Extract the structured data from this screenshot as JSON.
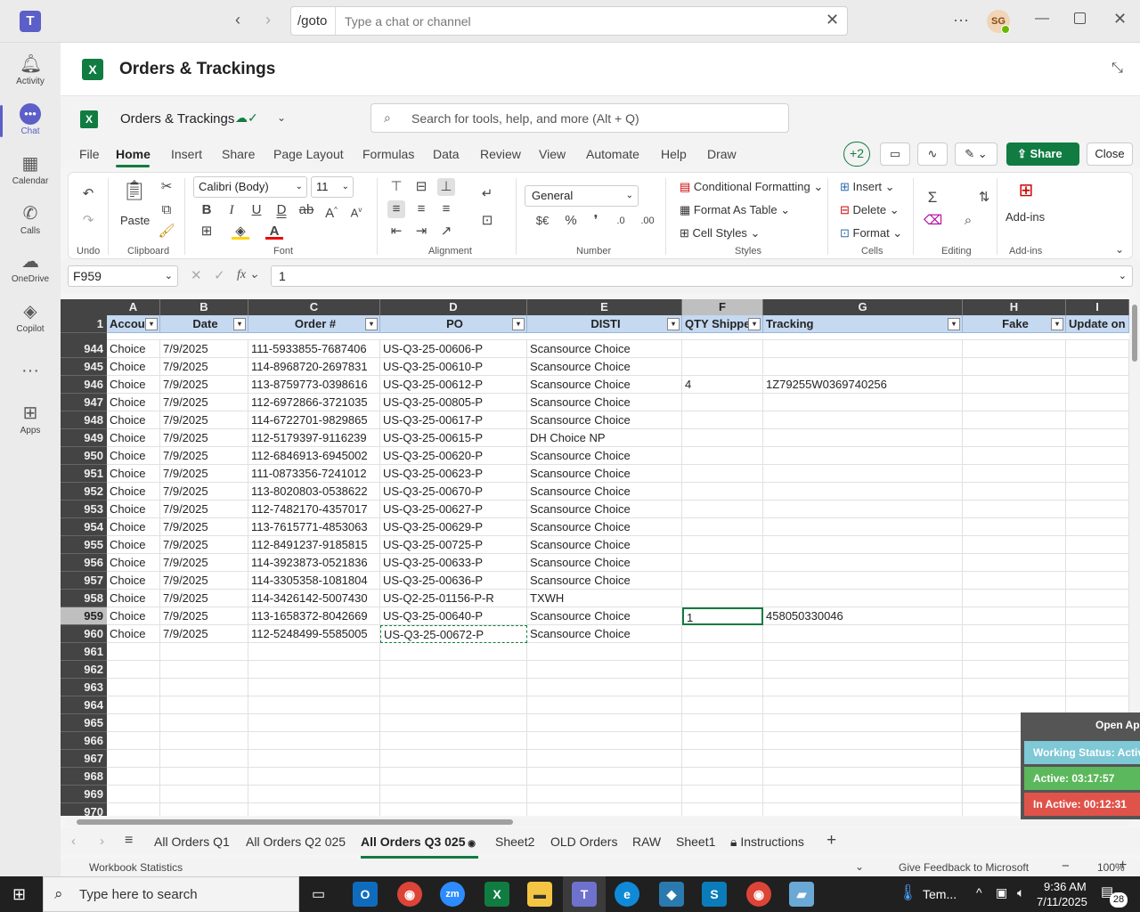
{
  "teams": {
    "goto_label": "/goto",
    "search_placeholder": "Type a chat or channel",
    "avatar_initials": "SG",
    "rail": [
      {
        "label": "Activity",
        "icon": "bell-icon"
      },
      {
        "label": "Chat",
        "icon": "chat-icon"
      },
      {
        "label": "Calendar",
        "icon": "calendar-icon"
      },
      {
        "label": "Calls",
        "icon": "phone-icon"
      },
      {
        "label": "OneDrive",
        "icon": "cloud-icon"
      },
      {
        "label": "Copilot",
        "icon": "copilot-icon"
      },
      {
        "label": "Apps",
        "icon": "apps-icon"
      }
    ]
  },
  "app": {
    "title": "Orders & Trackings"
  },
  "excel": {
    "file_name": "Orders & Trackings",
    "search_placeholder": "Search for tools, help, and more (Alt + Q)",
    "menu_tabs": [
      "File",
      "Home",
      "Insert",
      "Share",
      "Page Layout",
      "Formulas",
      "Data",
      "Review",
      "View",
      "Automate",
      "Help",
      "Draw"
    ],
    "selected_tab": "Home",
    "presence_count": "+2",
    "share_label": "Share",
    "close_label": "Close",
    "ribbon": {
      "undo_label": "Undo",
      "paste_label": "Paste",
      "clipboard_label": "Clipboard",
      "font_name": "Calibri (Body)",
      "font_size": "11",
      "font_label": "Font",
      "alignment_label": "Alignment",
      "number_format": "General",
      "number_label": "Number",
      "conditional_formatting": "Conditional Formatting",
      "format_as_table": "Format As Table",
      "cell_styles": "Cell Styles",
      "styles_label": "Styles",
      "insert": "Insert",
      "delete": "Delete",
      "format": "Format",
      "cells_label": "Cells",
      "editing_label": "Editing",
      "addins_btn": "Add-ins",
      "addins_label": "Add-ins"
    },
    "name_box": "F959",
    "formula_value": "1",
    "columns": [
      {
        "letter": "A",
        "header": "Accou"
      },
      {
        "letter": "B",
        "header": "Date"
      },
      {
        "letter": "C",
        "header": "Order #"
      },
      {
        "letter": "D",
        "header": "PO"
      },
      {
        "letter": "E",
        "header": "DISTI"
      },
      {
        "letter": "F",
        "header": "QTY Shipped"
      },
      {
        "letter": "G",
        "header": "Tracking"
      },
      {
        "letter": "H",
        "header": "Fake"
      },
      {
        "letter": "I",
        "header": "Update on A"
      }
    ],
    "header_row_number": "1",
    "rows": [
      {
        "n": "944",
        "a": "Choice",
        "b": "7/9/2025",
        "c": "111-5933855-7687406",
        "d": "US-Q3-25-00606-P",
        "e": "Scansource Choice",
        "f": "",
        "g": ""
      },
      {
        "n": "945",
        "a": "Choice",
        "b": "7/9/2025",
        "c": "114-8968720-2697831",
        "d": "US-Q3-25-00610-P",
        "e": "Scansource Choice",
        "f": "",
        "g": ""
      },
      {
        "n": "946",
        "a": "Choice",
        "b": "7/9/2025",
        "c": "113-8759773-0398616",
        "d": "US-Q3-25-00612-P",
        "e": "Scansource Choice",
        "f": "4",
        "g": "1Z79255W0369740256"
      },
      {
        "n": "947",
        "a": "Choice",
        "b": "7/9/2025",
        "c": "112-6972866-3721035",
        "d": "US-Q3-25-00805-P",
        "e": "Scansource Choice",
        "f": "",
        "g": ""
      },
      {
        "n": "948",
        "a": "Choice",
        "b": "7/9/2025",
        "c": "114-6722701-9829865",
        "d": "US-Q3-25-00617-P",
        "e": "Scansource Choice",
        "f": "",
        "g": ""
      },
      {
        "n": "949",
        "a": "Choice",
        "b": "7/9/2025",
        "c": "112-5179397-9116239",
        "d": "US-Q3-25-00615-P",
        "e": "DH Choice NP",
        "f": "",
        "g": ""
      },
      {
        "n": "950",
        "a": "Choice",
        "b": "7/9/2025",
        "c": "112-6846913-6945002",
        "d": "US-Q3-25-00620-P",
        "e": "Scansource Choice",
        "f": "",
        "g": ""
      },
      {
        "n": "951",
        "a": "Choice",
        "b": "7/9/2025",
        "c": "111-0873356-7241012",
        "d": "US-Q3-25-00623-P",
        "e": "Scansource Choice",
        "f": "",
        "g": ""
      },
      {
        "n": "952",
        "a": "Choice",
        "b": "7/9/2025",
        "c": "113-8020803-0538622",
        "d": "US-Q3-25-00670-P",
        "e": "Scansource Choice",
        "f": "",
        "g": ""
      },
      {
        "n": "953",
        "a": "Choice",
        "b": "7/9/2025",
        "c": "112-7482170-4357017",
        "d": "US-Q3-25-00627-P",
        "e": "Scansource Choice",
        "f": "",
        "g": ""
      },
      {
        "n": "954",
        "a": "Choice",
        "b": "7/9/2025",
        "c": "113-7615771-4853063",
        "d": "US-Q3-25-00629-P",
        "e": "Scansource Choice",
        "f": "",
        "g": ""
      },
      {
        "n": "955",
        "a": "Choice",
        "b": "7/9/2025",
        "c": "112-8491237-9185815",
        "d": "US-Q3-25-00725-P",
        "e": "Scansource Choice",
        "f": "",
        "g": ""
      },
      {
        "n": "956",
        "a": "Choice",
        "b": "7/9/2025",
        "c": "114-3923873-0521836",
        "d": "US-Q3-25-00633-P",
        "e": "Scansource Choice",
        "f": "",
        "g": ""
      },
      {
        "n": "957",
        "a": "Choice",
        "b": "7/9/2025",
        "c": "114-3305358-1081804",
        "d": "US-Q3-25-00636-P",
        "e": "Scansource Choice",
        "f": "",
        "g": ""
      },
      {
        "n": "958",
        "a": "Choice",
        "b": "7/9/2025",
        "c": "114-3426142-5007430",
        "d": "US-Q2-25-01156-P-R",
        "e": "TXWH",
        "f": "",
        "g": ""
      },
      {
        "n": "959",
        "a": "Choice",
        "b": "7/9/2025",
        "c": "113-1658372-8042669",
        "d": "US-Q3-25-00640-P",
        "e": "Scansource Choice",
        "f": "1",
        "g": "458050330046"
      },
      {
        "n": "960",
        "a": "Choice",
        "b": "7/9/2025",
        "c": "112-5248499-5585005",
        "d": "US-Q3-25-00672-P",
        "e": "Scansource Choice",
        "f": "",
        "g": ""
      }
    ],
    "empty_rows": [
      "961",
      "962",
      "963",
      "964",
      "965",
      "966",
      "967",
      "968",
      "969",
      "970"
    ],
    "sheet_tabs": [
      "All Orders Q1",
      "All Orders Q2 025",
      "All Orders Q3 025",
      "Sheet2",
      "OLD Orders",
      "RAW",
      "Sheet1",
      "Instructions"
    ],
    "active_sheet": "All Orders Q3 025",
    "status_left": "Workbook Statistics",
    "feedback": "Give Feedback to Microsoft",
    "zoom": "100%"
  },
  "overlay": {
    "open_app": "Open Ap",
    "working_status": "Working Status: Active",
    "active_time": "Active: 03:17:57",
    "inactive_time": "In Active: 00:12:31"
  },
  "taskbar": {
    "search_placeholder": "Type here to search",
    "weather": "Tem...",
    "time": "9:36 AM",
    "date": "7/11/2025",
    "notifications": "28"
  },
  "colors": {
    "teams_accent": "#5b5fc7",
    "excel_green": "#107c41",
    "header_fill": "#c5d9f1"
  }
}
